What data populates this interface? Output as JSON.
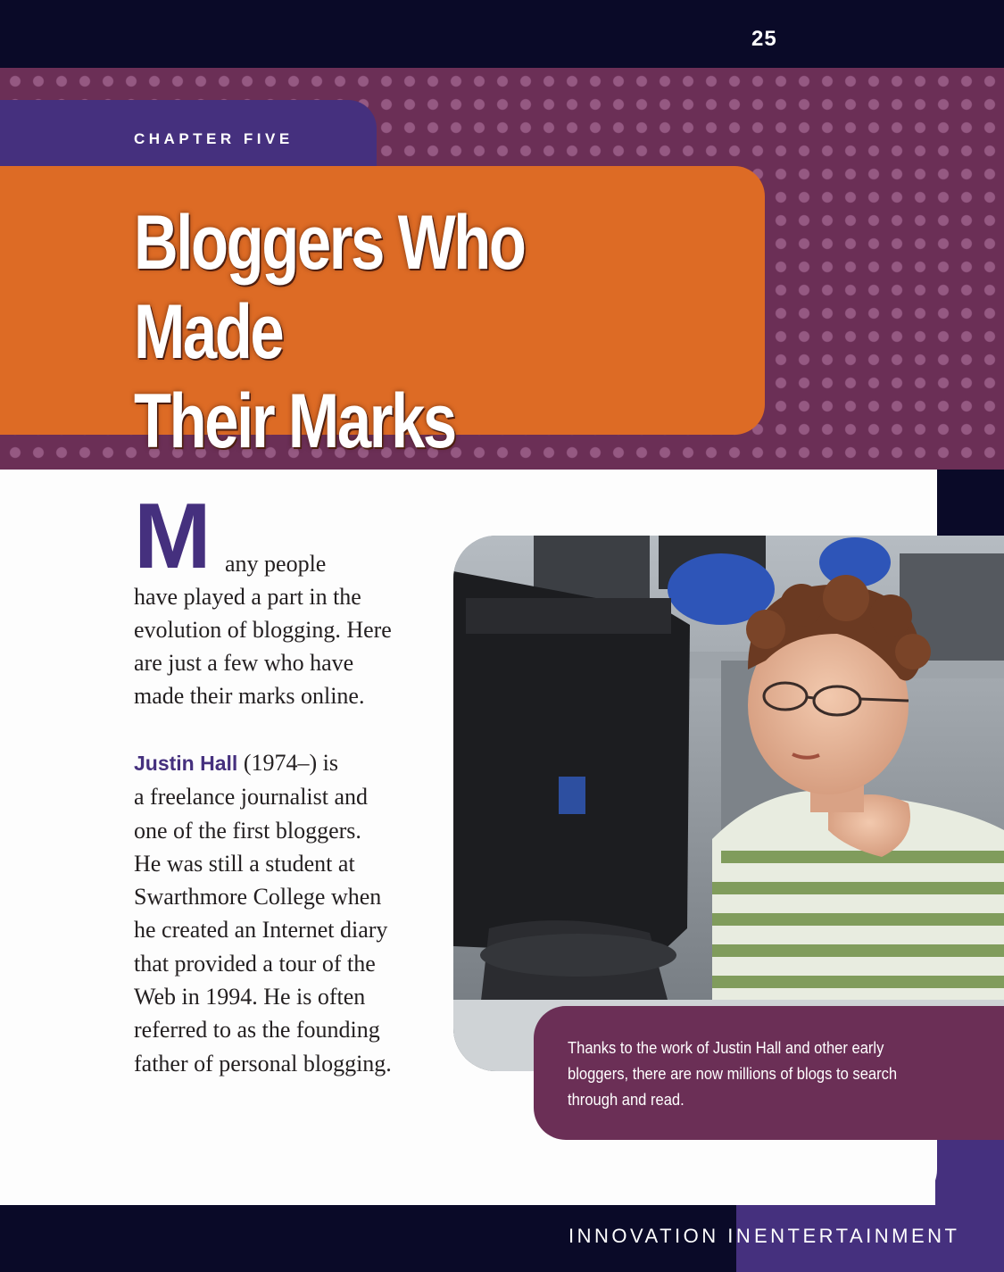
{
  "page": {
    "number": "25",
    "chapter_label": "CHAPTER FIVE",
    "title": "Bloggers Who Made\nTheir Marks"
  },
  "intro": {
    "dropcap": "M",
    "first_line": "any people",
    "rest": "have played a part in the\nevolution of blogging. Here\nare just a few who have\nmade their marks online."
  },
  "bio": {
    "name": "Justin Hall",
    "text": " (1974–) is\na freelance journalist and\none of the first bloggers.\nHe was still a student at\nSwarthmore College when\nhe created an Internet diary\nthat provided a tour of the\nWeb in 1994. He is often\nreferred to as the founding\nfather of personal blogging."
  },
  "photo": {
    "caption": "Thanks to the work of Justin Hall and other early\nbloggers, there are now millions of blogs to search\nthrough and read."
  },
  "footer": {
    "series_left": "INNOVATION IN",
    "series_right": "ENTERTAINMENT"
  },
  "colors": {
    "banner_plum": "#6b2f56",
    "title_orange": "#dd6b25",
    "chapter_purple": "#45307e",
    "dark_navy": "#0a0a28"
  }
}
